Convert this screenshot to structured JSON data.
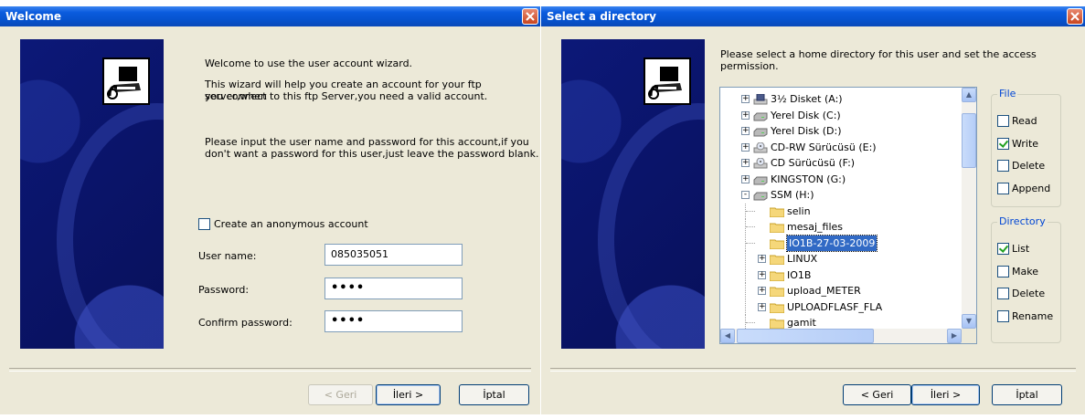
{
  "welcome": {
    "title": "Welcome",
    "intro_line1": "Welcome to use the user account wizard.",
    "intro_line2a": "This wizard will help you create an account for your ftp server,when",
    "intro_line2b": "you  connect to this ftp Server,you need a valid account.",
    "info_line1": "Please input the user name and password for this account,if you",
    "info_line2": "don't want a password for this user,just leave the password blank.",
    "anonymous_label": "Create an anonymous account",
    "anonymous_checked": false,
    "username_label": "User name:",
    "username_value": "085035051",
    "password_label": "Password:",
    "password_value": "••••",
    "confirm_label": "Confirm password:",
    "confirm_value": "••••",
    "back_button": "< Geri",
    "next_button": "İleri >",
    "cancel_button": "İptal"
  },
  "directory": {
    "title": "Select a directory",
    "instruction_line1": "Please select a home directory for this user and set the access",
    "instruction_line2": "permission.",
    "tree": [
      {
        "label": "3½ Disket (A:)",
        "icon": "floppy-icon",
        "expander": "+"
      },
      {
        "label": "Yerel Disk (C:)",
        "icon": "drive-icon",
        "expander": "+"
      },
      {
        "label": "Yerel Disk (D:)",
        "icon": "drive-icon",
        "expander": "+"
      },
      {
        "label": "CD-RW Sürücüsü (E:)",
        "icon": "cd-icon",
        "expander": "+"
      },
      {
        "label": "CD Sürücüsü (F:)",
        "icon": "cd-icon",
        "expander": "+"
      },
      {
        "label": "KINGSTON (G:)",
        "icon": "drive-icon",
        "expander": "+"
      },
      {
        "label": "SSM (H:)",
        "icon": "drive-icon",
        "expander": "-"
      },
      {
        "label": "selin",
        "icon": "folder-icon",
        "expander": ""
      },
      {
        "label": "mesaj_files",
        "icon": "folder-icon",
        "expander": ""
      },
      {
        "label": "IO1B-27-03-2009",
        "icon": "folder-icon",
        "expander": "",
        "selected": true
      },
      {
        "label": "LINUX",
        "icon": "folder-icon",
        "expander": "+"
      },
      {
        "label": "IO1B",
        "icon": "folder-icon",
        "expander": "+"
      },
      {
        "label": "upload_METER",
        "icon": "folder-icon",
        "expander": "+"
      },
      {
        "label": "UPLOADFLASF_FLA",
        "icon": "folder-icon",
        "expander": "+"
      },
      {
        "label": "gamit",
        "icon": "folder-icon",
        "expander": ""
      }
    ],
    "file_group": {
      "label": "File",
      "items": [
        {
          "label": "Read",
          "checked": false
        },
        {
          "label": "Write",
          "checked": true
        },
        {
          "label": "Delete",
          "checked": false
        },
        {
          "label": "Append",
          "checked": false
        }
      ]
    },
    "directory_group": {
      "label": "Directory",
      "items": [
        {
          "label": "List",
          "checked": true
        },
        {
          "label": "Make",
          "checked": false
        },
        {
          "label": "Delete",
          "checked": false
        },
        {
          "label": "Rename",
          "checked": false
        }
      ]
    },
    "back_button": "< Geri",
    "next_button": "İleri >",
    "cancel_button": "İptal"
  }
}
